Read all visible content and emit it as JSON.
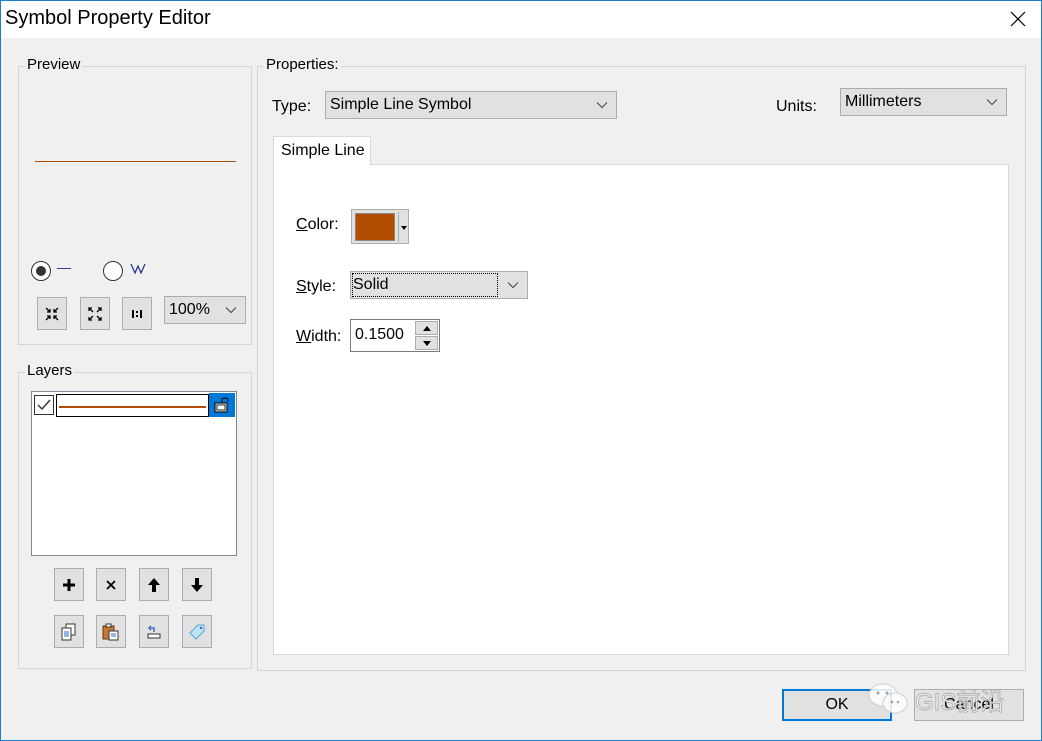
{
  "window": {
    "title": "Symbol Property Editor"
  },
  "preview": {
    "label": "Preview",
    "line_color": "#b34e00",
    "radio_line_glyph": "—",
    "radio_zigzag_glyph": "ʌʌ",
    "selected_mode": "line",
    "zoom_value": "100%",
    "buttons": [
      "zoom-in-icon",
      "zoom-out-icon",
      "actual-size-icon"
    ]
  },
  "layers": {
    "label": "Layers",
    "items": [
      {
        "checked": true,
        "line_color": "#b34e00",
        "locked": false,
        "selected": true
      }
    ],
    "buttons_row1": [
      "add-layer",
      "remove-layer",
      "move-up",
      "move-down"
    ],
    "buttons_row2": [
      "copy-layer",
      "paste-layer",
      "reset-layer",
      "tag-layer"
    ]
  },
  "properties": {
    "label": "Properties:",
    "type_label": "Type:",
    "type_value": "Simple Line Symbol",
    "units_label": "Units:",
    "units_value": "Millimeters",
    "tabs": [
      {
        "label": "Simple Line",
        "active": true
      }
    ],
    "color_label_hot": "C",
    "color_label_rest": "olor:",
    "color_value": "#b34e00",
    "style_label_hot": "S",
    "style_label_rest": "tyle:",
    "style_value": "Solid",
    "width_label_hot": "W",
    "width_label_rest": "idth:",
    "width_value": "0.1500"
  },
  "footer": {
    "ok_label": "OK",
    "cancel_label": "Cancel",
    "watermark": "GIS前沿"
  }
}
